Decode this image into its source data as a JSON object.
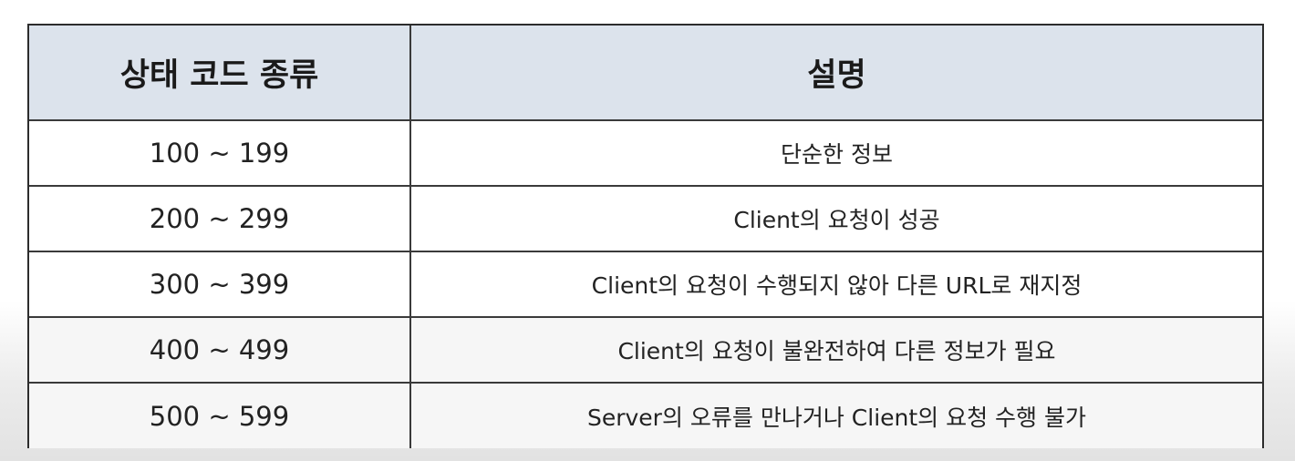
{
  "table": {
    "headers": {
      "code": "상태 코드 종류",
      "description": "설명"
    },
    "rows": [
      {
        "code": "100 ~ 199",
        "description": "단순한 정보"
      },
      {
        "code": "200 ~ 299",
        "description": "Client의 요청이 성공"
      },
      {
        "code": "300 ~ 399",
        "description": "Client의 요청이 수행되지 않아 다른 URL로 재지정"
      },
      {
        "code": "400 ~ 499",
        "description": "Client의 요청이 불완전하여 다른 정보가 필요"
      },
      {
        "code": "500 ~ 599",
        "description": "Server의 오류를 만나거나 Client의 요청 수행 불가"
      }
    ]
  },
  "colors": {
    "header_background": "#dce3ec",
    "border": "#2c2c2c"
  }
}
